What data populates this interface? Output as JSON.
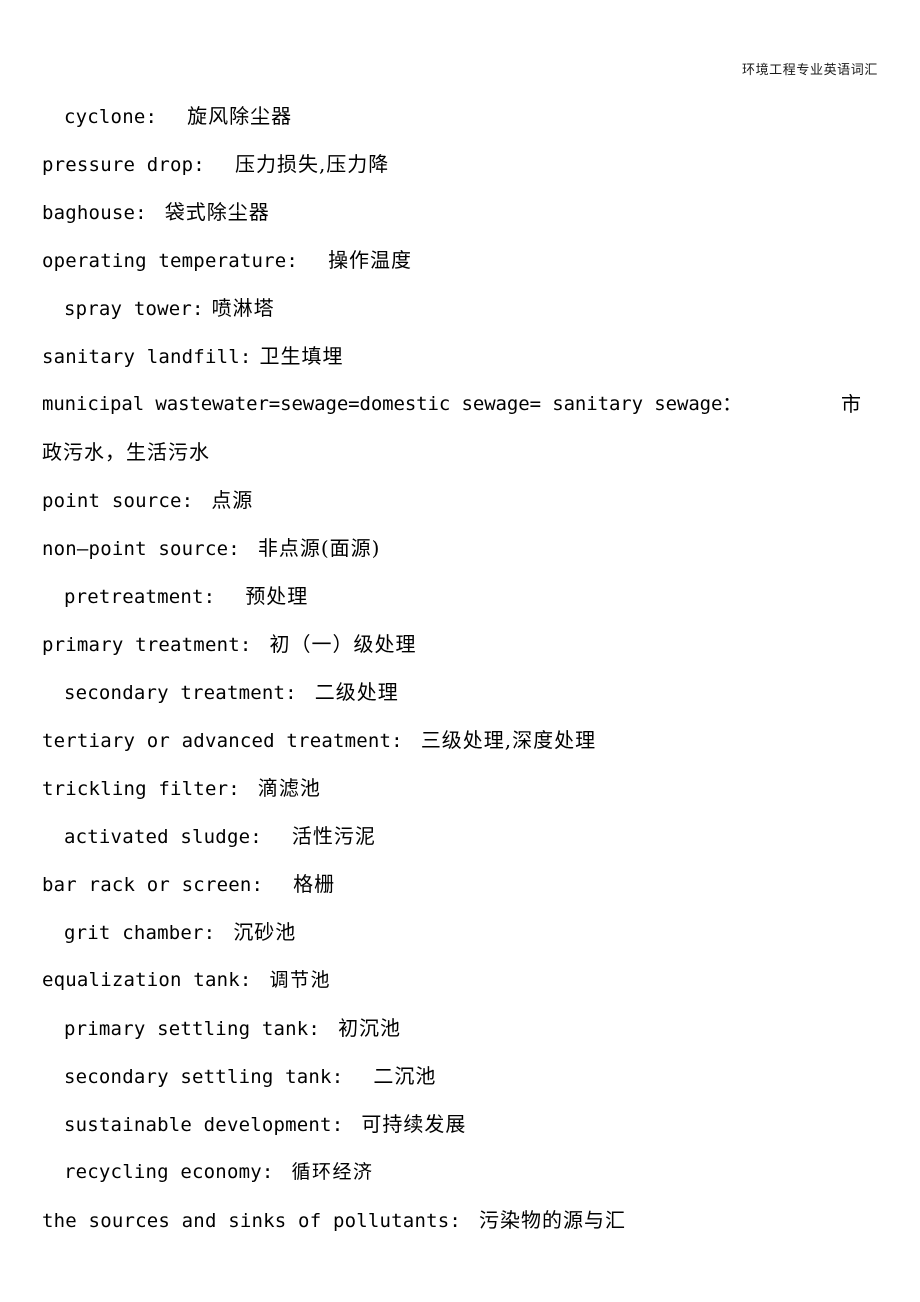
{
  "header": {
    "running_title": "环境工程专业英语词汇"
  },
  "document": {
    "entries": [
      {
        "indent": true,
        "en": "cyclone:",
        "gap": "lg",
        "cn": "旋风除尘器",
        "cn_style": "kai"
      },
      {
        "indent": false,
        "en": "pressure  drop:",
        "gap": "lg",
        "cn": "压力损失,压力降",
        "cn_style": "kai"
      },
      {
        "indent": false,
        "en": "baghouse:",
        "gap": "md",
        "cn": "袋式除尘器",
        "cn_style": "kai"
      },
      {
        "indent": false,
        "en": "operating  temperature:",
        "gap": "lg",
        "cn": "操作温度",
        "cn_style": "kai"
      },
      {
        "indent": true,
        "en": "spray  tower:",
        "gap": "sm",
        "cn": "喷淋塔",
        "cn_style": "kai"
      },
      {
        "indent": false,
        "en": "sanitary  landfill:",
        "gap": "sm",
        "cn": "卫生填埋",
        "cn_style": "kai"
      },
      {
        "indent": false,
        "en": "point  source:",
        "gap": "md",
        "cn": "点源",
        "cn_style": "kai"
      },
      {
        "indent": false,
        "en": "non—point  source:",
        "gap": "md",
        "cn": "非点源(面源)",
        "cn_style": "kai"
      },
      {
        "indent": true,
        "en": "pretreatment:",
        "gap": "lg",
        "cn": "预处理",
        "cn_style": "kai"
      },
      {
        "indent": false,
        "en": "primary  treatment:",
        "gap": "md",
        "cn": "初（一）级处理",
        "cn_style": "kai"
      },
      {
        "indent": true,
        "en": "secondary  treatment:",
        "gap": "md",
        "cn": "二级处理",
        "cn_style": "kai"
      },
      {
        "indent": false,
        "en": "tertiary  or  advanced  treatment:",
        "gap": "md",
        "cn": "三级处理,深度处理",
        "cn_style": "kai"
      },
      {
        "indent": false,
        "en": "trickling  filter:",
        "gap": "md",
        "cn": "滴滤池",
        "cn_style": "kai"
      },
      {
        "indent": true,
        "en": "activated  sludge:",
        "gap": "lg",
        "cn": "活性污泥",
        "cn_style": "kai"
      },
      {
        "indent": false,
        "en": "bar  rack  or  screen:",
        "gap": "lg",
        "cn": "格栅",
        "cn_style": "kai"
      },
      {
        "indent": true,
        "en": "grit  chamber:",
        "gap": "md",
        "cn": "沉砂池",
        "cn_style": "kai"
      },
      {
        "indent": false,
        "en": "equalization  tank:",
        "gap": "md",
        "cn": "调节池",
        "cn_style": "song"
      },
      {
        "indent": true,
        "en": "primary  settling  tank:",
        "gap": "md",
        "cn": "初沉池",
        "cn_style": "kai"
      },
      {
        "indent": true,
        "en": "secondary  settling  tank:",
        "gap": "lg",
        "cn": "二沉池",
        "cn_style": "kai"
      },
      {
        "indent": true,
        "en": "sustainable  development:",
        "gap": "md",
        "cn": "可持续发展",
        "cn_style": "kai"
      },
      {
        "indent": true,
        "en": "recycling  economy:",
        "gap": "md",
        "cn": "循环经济",
        "cn_style": "song"
      },
      {
        "indent": false,
        "en": "the  sources  and  sinks  of  pollutants:",
        "gap": "md",
        "cn": "污染物的源与汇",
        "cn_style": "kai"
      }
    ],
    "wide_entry": {
      "position_after": 5,
      "en": "municipal  wastewater=sewage=domestic  sewage=  sanitary  sewage：",
      "tail_cn": "市",
      "continuation_cn": "政污水，生活污水"
    }
  }
}
